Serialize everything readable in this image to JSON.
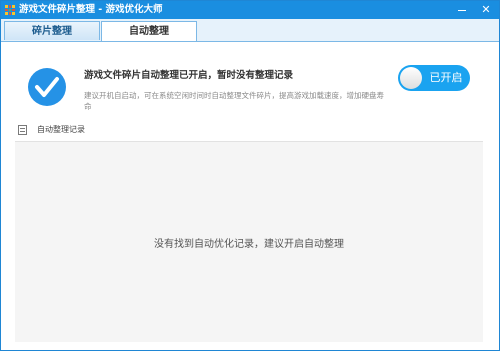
{
  "window": {
    "title": "游戏文件碎片整理 - 游戏优化大师",
    "minimize_label": "—",
    "close_label": "✕"
  },
  "tabs": [
    {
      "label": "碎片整理",
      "active": false
    },
    {
      "label": "自动整理",
      "active": true
    }
  ],
  "status": {
    "icon": "check-circle-icon",
    "title": "游戏文件碎片自动整理已开启，暂时没有整理记录",
    "description": "建议开机自启动，可在系统空闲时间时自动整理文件碎片，提高游戏加载速度，增加硬盘寿命",
    "toggle_label": "已开启"
  },
  "records": {
    "label": "自动整理记录",
    "icon": "record-list-icon",
    "empty_message": "没有找到自动优化记录，建议开启自动整理"
  },
  "colors": {
    "titlebar": "#1a8ee0",
    "accent": "#1aa3f0",
    "check_blue": "#2592e6"
  }
}
